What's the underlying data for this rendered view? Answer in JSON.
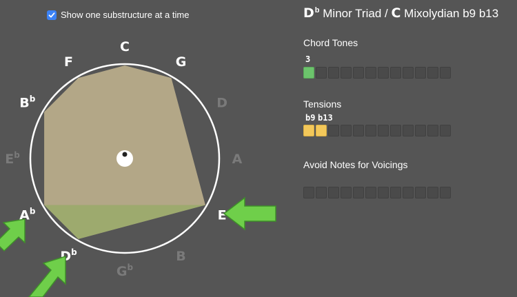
{
  "checkbox": {
    "label": "Show one substructure at a time",
    "checked": true
  },
  "title": {
    "root": "D",
    "root_accidental": "b",
    "chord": "Minor Triad",
    "separator": "/",
    "scale_root": "C",
    "scale": "Mixolydian b9 b13"
  },
  "chord_tones": {
    "label": "Chord Tones",
    "degree_labels": [
      "3"
    ],
    "cells": [
      "green",
      "empty",
      "empty",
      "empty",
      "empty",
      "empty",
      "empty",
      "empty",
      "empty",
      "empty",
      "empty",
      "empty"
    ]
  },
  "tensions": {
    "label": "Tensions",
    "degree_labels": [
      "b9",
      "b13"
    ],
    "cells": [
      "yellow",
      "yellow",
      "empty",
      "empty",
      "empty",
      "empty",
      "empty",
      "empty",
      "empty",
      "empty",
      "empty",
      "empty"
    ]
  },
  "avoid_notes": {
    "label": "Avoid Notes for Voicings",
    "cells": [
      "empty",
      "empty",
      "empty",
      "empty",
      "empty",
      "empty",
      "empty",
      "empty",
      "empty",
      "empty",
      "empty",
      "empty"
    ]
  },
  "wheel": {
    "notes": [
      {
        "name": "C",
        "acc": "",
        "active": true
      },
      {
        "name": "G",
        "acc": "",
        "active": true
      },
      {
        "name": "D",
        "acc": "",
        "active": false
      },
      {
        "name": "A",
        "acc": "",
        "active": false
      },
      {
        "name": "E",
        "acc": "",
        "active": true
      },
      {
        "name": "B",
        "acc": "",
        "active": false
      },
      {
        "name": "G",
        "acc": "b",
        "active": false
      },
      {
        "name": "D",
        "acc": "b",
        "active": true
      },
      {
        "name": "A",
        "acc": "b",
        "active": true
      },
      {
        "name": "E",
        "acc": "b",
        "active": false
      },
      {
        "name": "B",
        "acc": "b",
        "active": true
      },
      {
        "name": "F",
        "acc": "",
        "active": true
      }
    ],
    "colors": {
      "circle": "#ffffff",
      "scale_fill": "#b8ac8a",
      "substructure_fill": "#9aab6c",
      "inactive_label": "#7a7a7a",
      "active_label": "#ffffff",
      "arrow": "#6fcf4a"
    }
  }
}
